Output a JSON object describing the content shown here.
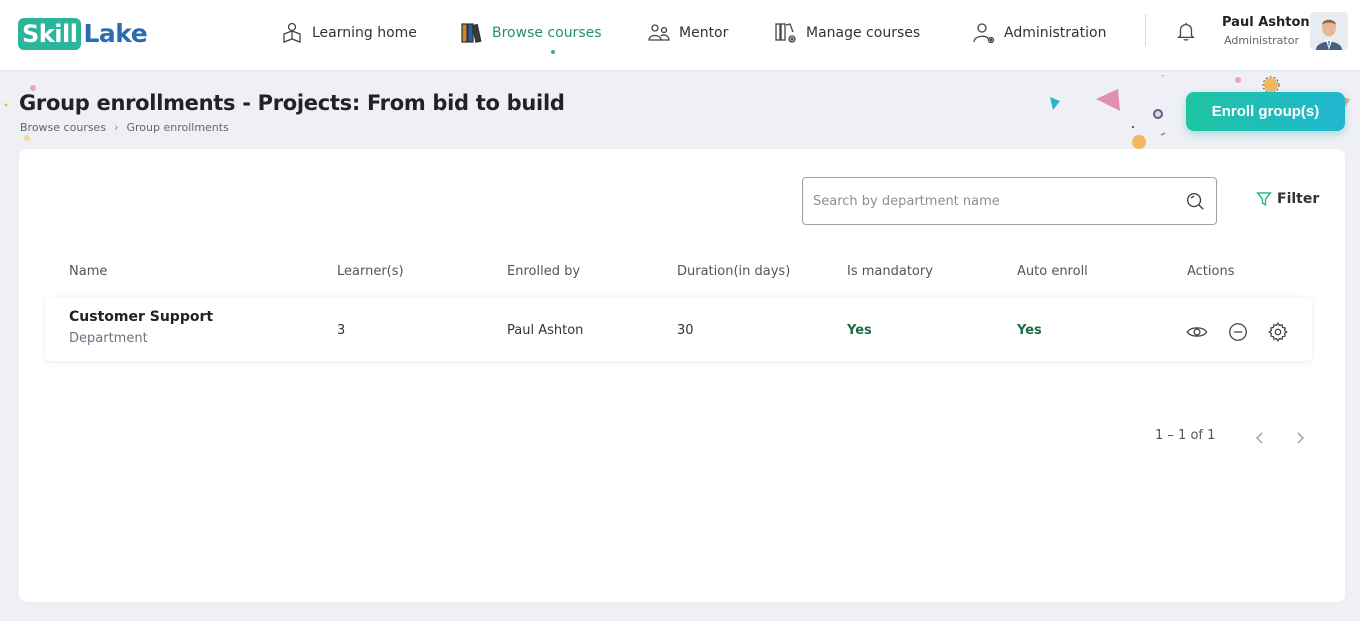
{
  "header": {
    "logo": {
      "part1": "Skill",
      "part2": "Lake"
    },
    "nav": [
      {
        "label": "Learning home",
        "icon": "learning-home-icon"
      },
      {
        "label": "Browse courses",
        "icon": "books-icon",
        "active": true
      },
      {
        "label": "Mentor",
        "icon": "mentor-icon"
      },
      {
        "label": "Manage courses",
        "icon": "manage-courses-icon"
      },
      {
        "label": "Administration",
        "icon": "administration-icon"
      }
    ],
    "user": {
      "name": "Paul Ashton",
      "role": "Administrator"
    }
  },
  "page": {
    "title": "Group enrollments - Projects: From bid to build",
    "breadcrumb": [
      "Browse courses",
      "Group enrollments"
    ],
    "enroll_button": "Enroll group(s)"
  },
  "toolbar": {
    "search_placeholder": "Search by department name",
    "filter_label": "Filter"
  },
  "table": {
    "columns": [
      "Name",
      "Learner(s)",
      "Enrolled by",
      "Duration(in days)",
      "Is mandatory",
      "Auto enroll",
      "Actions"
    ],
    "rows": [
      {
        "name": "Customer Support",
        "type": "Department",
        "learners": "3",
        "enrolled_by": "Paul Ashton",
        "duration": "30",
        "is_mandatory": "Yes",
        "auto_enroll": "Yes"
      }
    ]
  },
  "pagination": {
    "label": "1 – 1 of 1"
  },
  "colors": {
    "accent": "#2bb59a",
    "button_start": "#1fc4a2",
    "button_end": "#21b6d0",
    "yes": "#1f6b45"
  }
}
